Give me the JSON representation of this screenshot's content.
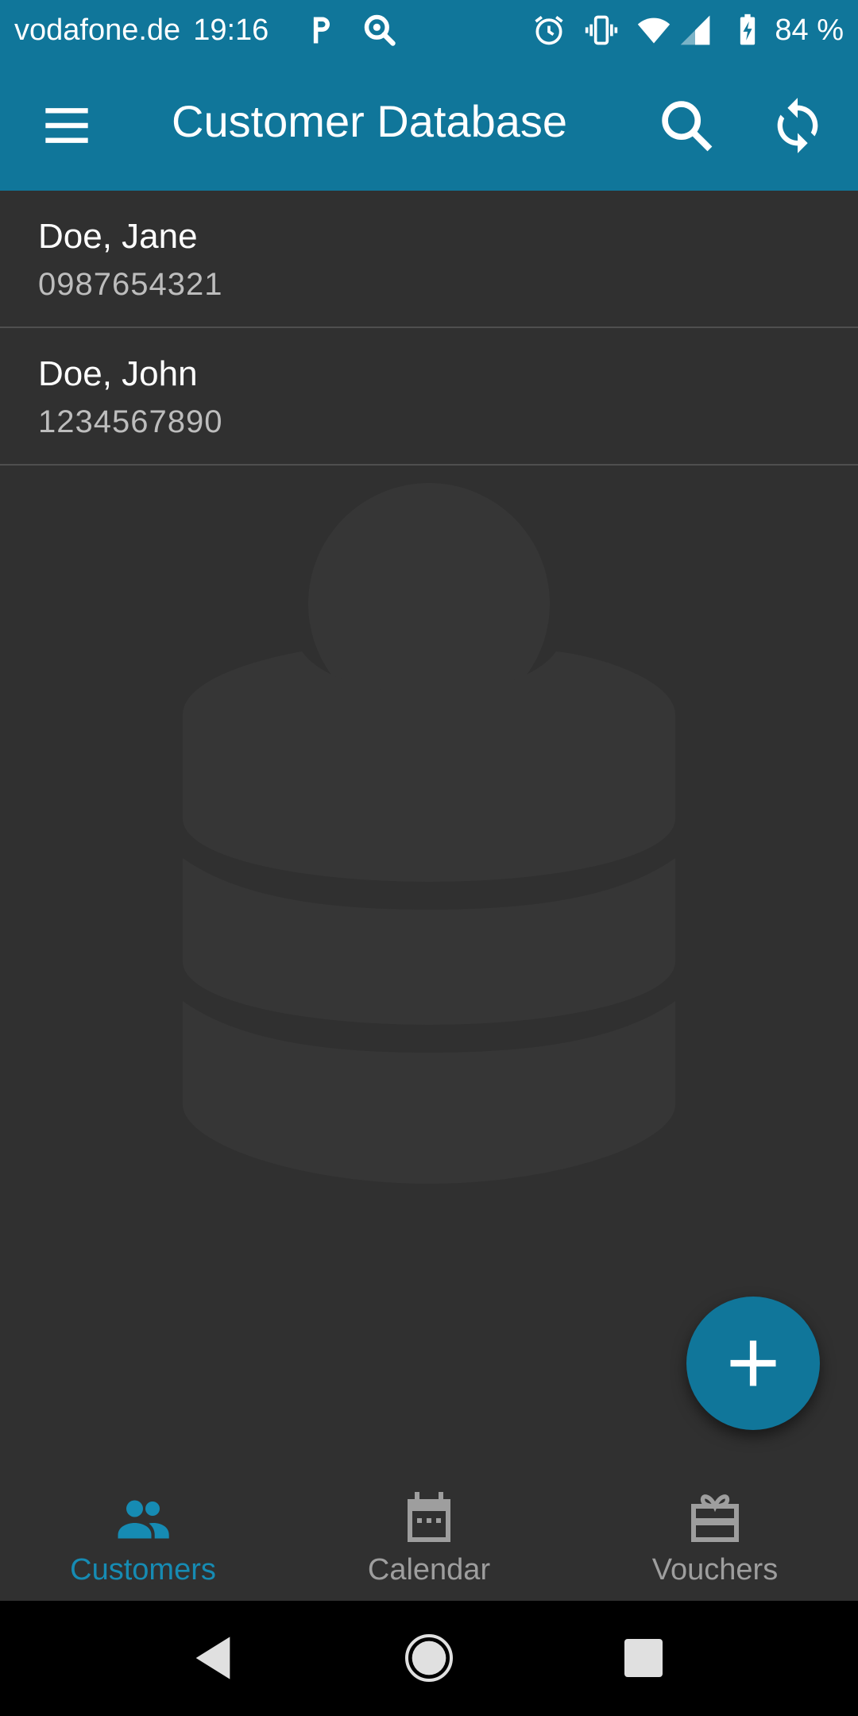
{
  "status_bar": {
    "carrier": "vodafone.de",
    "time": "19:16",
    "battery": "84 %",
    "icons": [
      "parking-app-icon",
      "search-app-icon",
      "alarm-icon",
      "vibrate-icon",
      "wifi-icon",
      "signal-icon",
      "battery-charging-icon"
    ]
  },
  "app_bar": {
    "title": "Customer Database",
    "icons": [
      "menu-icon",
      "search-icon",
      "sync-icon"
    ]
  },
  "customers": [
    {
      "name": "Doe, Jane",
      "phone": "0987654321"
    },
    {
      "name": "Doe, John",
      "phone": "1234567890"
    }
  ],
  "fab": {
    "icon": "plus-icon"
  },
  "bottom_nav": {
    "items": [
      {
        "label": "Customers",
        "icon": "people-icon",
        "active": true
      },
      {
        "label": "Calendar",
        "icon": "calendar-icon",
        "active": false
      },
      {
        "label": "Vouchers",
        "icon": "gift-card-icon",
        "active": false
      }
    ]
  },
  "system_nav": {
    "icons": [
      "back-icon",
      "home-icon",
      "recents-icon"
    ]
  },
  "colors": {
    "primary": "#10769a",
    "accent": "#168bb3",
    "background": "#303030",
    "inactive": "#9e9e9e"
  }
}
